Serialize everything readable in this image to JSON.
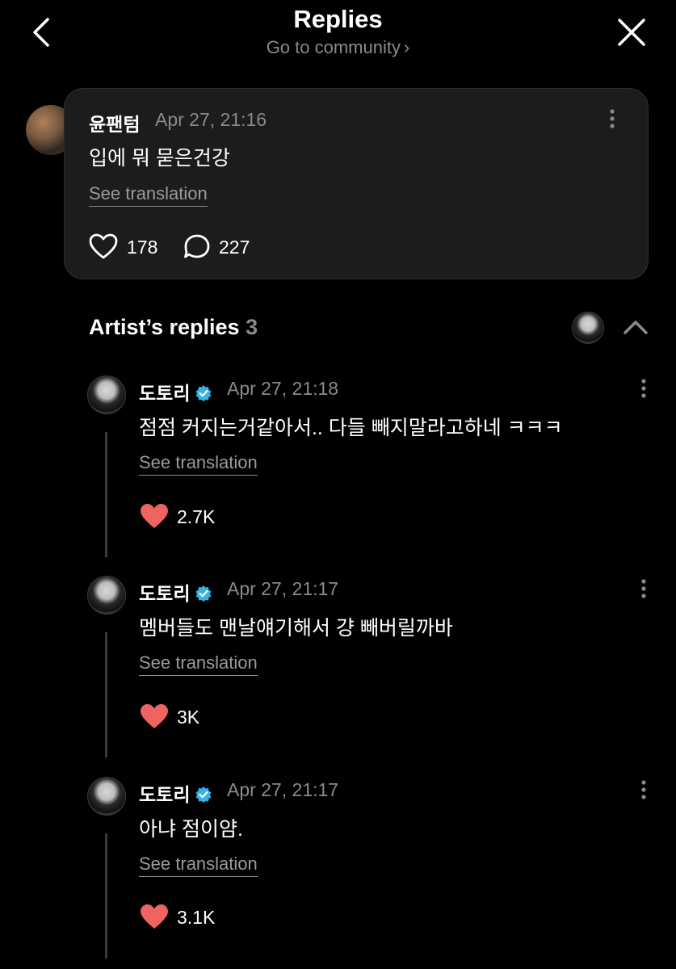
{
  "header": {
    "title": "Replies",
    "subtitle": "Go to community",
    "back_icon": "chevron-left-icon",
    "close_icon": "close-icon"
  },
  "comment": {
    "author": "윤팬텀",
    "time": "Apr 27, 21:16",
    "text": "입에 뭐 묻은건강",
    "see_translation": "See translation",
    "likes": "178",
    "replies": "227"
  },
  "artist_replies": {
    "label": "Artist’s replies",
    "count": "3",
    "items": [
      {
        "author": "도토리",
        "time": "Apr 27, 21:18",
        "text": "점점 커지는거같아서.. 다들 빼지말라고하네 ㅋㅋㅋ",
        "see_translation": "See translation",
        "likes": "2.7K"
      },
      {
        "author": "도토리",
        "time": "Apr 27, 21:17",
        "text": "멤버들도 맨날얘기해서 걍 빼버릴까바",
        "see_translation": "See translation",
        "likes": "3K"
      },
      {
        "author": "도토리",
        "time": "Apr 27, 21:17",
        "text": "아냐 점이얌.",
        "see_translation": "See translation",
        "likes": "3.1K"
      }
    ]
  },
  "colors": {
    "background": "#000000",
    "card": "#1c1c1e",
    "muted": "#8a8a8a",
    "heart": "#ef6461",
    "verified": "#36b3e6"
  }
}
